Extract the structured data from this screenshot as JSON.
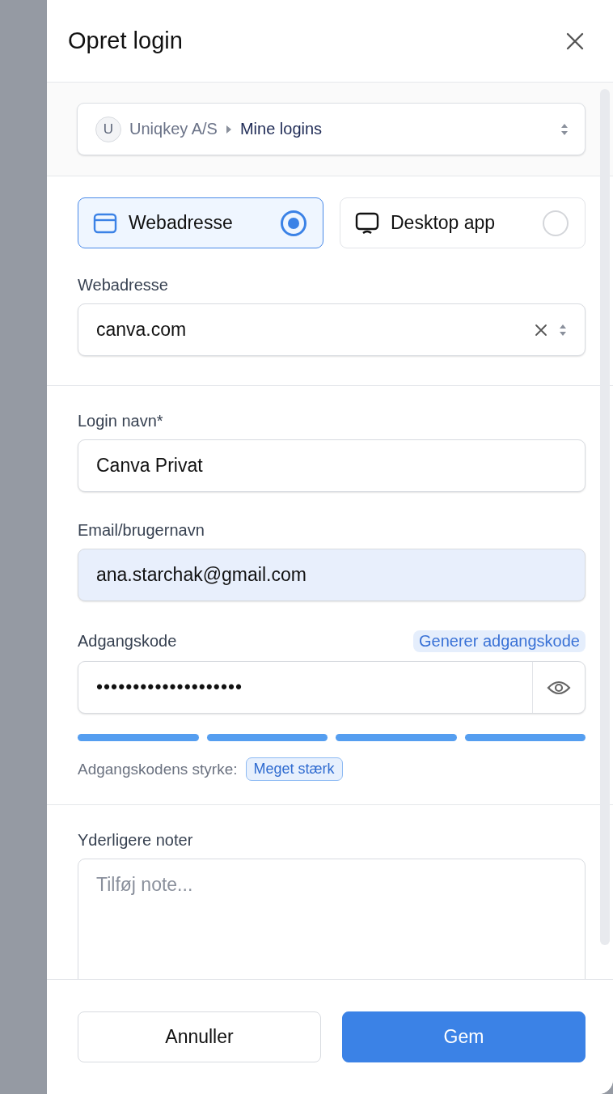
{
  "dialog": {
    "title": "Opret login"
  },
  "location": {
    "avatar": "U",
    "organization": "Uniqkey A/S",
    "folder": "Mine logins"
  },
  "login_types": [
    {
      "kind": "web",
      "label": "Webadresse",
      "selected": true
    },
    {
      "kind": "desktop",
      "label": "Desktop app",
      "selected": false
    }
  ],
  "url_field": {
    "label": "Webadresse",
    "value": "canva.com"
  },
  "name_field": {
    "label": "Login navn*",
    "value": "Canva Privat"
  },
  "email_field": {
    "label": "Email/brugernavn",
    "value": "ana.starchak@gmail.com",
    "autofilled": true
  },
  "password_field": {
    "label": "Adgangskode",
    "generate_link": "Generer adgangskode",
    "value": "••••••••••••••••••••"
  },
  "strength": {
    "segments": [
      {
        "filled": true
      },
      {
        "filled": true
      },
      {
        "filled": true
      },
      {
        "filled": true
      }
    ],
    "label": "Adgangskodens styrke:",
    "badge": "Meget stærk"
  },
  "notes_field": {
    "label": "Yderligere noter",
    "placeholder": "Tilføj note..."
  },
  "buttons": [
    {
      "kind": "secondary",
      "label": "Annuller"
    },
    {
      "kind": "primary",
      "label": "Gem"
    }
  ]
}
